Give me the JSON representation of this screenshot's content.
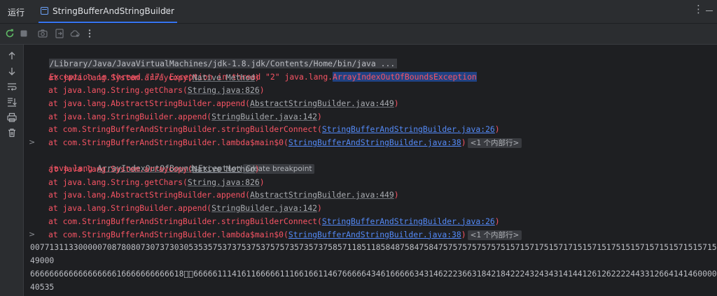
{
  "header": {
    "run_label": "运行",
    "tab_title": "StringBufferAndStringBuilder",
    "tab_close": "×",
    "more_glyph": "⋮"
  },
  "toolbar": {
    "icons": [
      "rerun-icon",
      "stop-icon",
      "camera-icon",
      "import-icon",
      "cloud-icon",
      "more-icon"
    ]
  },
  "sidebar": {
    "icons": [
      "up-arrow-icon",
      "down-arrow-icon",
      "soft-wrap-icon",
      "scroll-to-end-icon",
      "print-icon",
      "trash-icon"
    ]
  },
  "console": {
    "command": "/Library/Java/JavaVirtualMachines/jdk-1.8.jdk/Contents/Home/bin/java ...",
    "exception_prefix": "Exception in thread \"17\" Exception in thread \"2\" java.lang.",
    "exception_class": "ArrayIndexOutOfBoundsException",
    "trace1": [
      {
        "prefix": "at java.lang.System.arraycopy(",
        "link": "Native Method",
        "suffix": ")",
        "style": "grey"
      },
      {
        "prefix": "at java.lang.String.getChars(",
        "link": "String.java:826",
        "suffix": ")",
        "style": "grey"
      },
      {
        "prefix": "at java.lang.AbstractStringBuilder.append(",
        "link": "AbstractStringBuilder.java:449",
        "suffix": ")",
        "style": "grey"
      },
      {
        "prefix": "at java.lang.StringBuilder.append(",
        "link": "StringBuilder.java:142",
        "suffix": ")",
        "style": "grey"
      },
      {
        "prefix": "at com.StringBufferAndStringBuilder.stringBuilderConnect(",
        "link": "StringBufferAndStringBuilder.java:26",
        "suffix": ")",
        "style": "blue"
      },
      {
        "prefix": "at com.StringBufferAndStringBuilder.lambda$main$0(",
        "link": "StringBufferAndStringBuilder.java:38",
        "suffix": ")",
        "style": "blue",
        "badge": "<1 个内部行>",
        "chevron": ">"
      }
    ],
    "second_exception_prefix": "java.lang.",
    "second_exception_class": "ArrayIndexOutOfBoundsException",
    "breakpoint_tooltip": "Create breakpoint",
    "trace2": [
      {
        "prefix": "at java.lang.System.arraycopy(",
        "link": "Native Method",
        "suffix": ")",
        "style": "grey"
      },
      {
        "prefix": "at java.lang.String.getChars(",
        "link": "String.java:826",
        "suffix": ")",
        "style": "grey"
      },
      {
        "prefix": "at java.lang.AbstractStringBuilder.append(",
        "link": "AbstractStringBuilder.java:449",
        "suffix": ")",
        "style": "grey"
      },
      {
        "prefix": "at java.lang.StringBuilder.append(",
        "link": "StringBuilder.java:142",
        "suffix": ")",
        "style": "grey"
      },
      {
        "prefix": "at com.StringBufferAndStringBuilder.stringBuilderConnect(",
        "link": "StringBufferAndStringBuilder.java:26",
        "suffix": ")",
        "style": "blue"
      },
      {
        "prefix": "at com.StringBufferAndStringBuilder.lambda$main$0(",
        "link": "StringBufferAndStringBuilder.java:38",
        "suffix": ")",
        "style": "blue",
        "badge": "<1 个内部行>",
        "chevron": ">"
      }
    ],
    "output": [
      "007713113300000708780807307373030535357537375375375757357357375857118511858487584758475757575757575157157175157171515715175151571571515715157157157157",
      "49000",
      "66666666666666666616666666666618\u0000\u000066666111416116666611166166114676666643461666663431462223663184218422243243431414412612622224433126641414600000",
      "40535"
    ]
  }
}
